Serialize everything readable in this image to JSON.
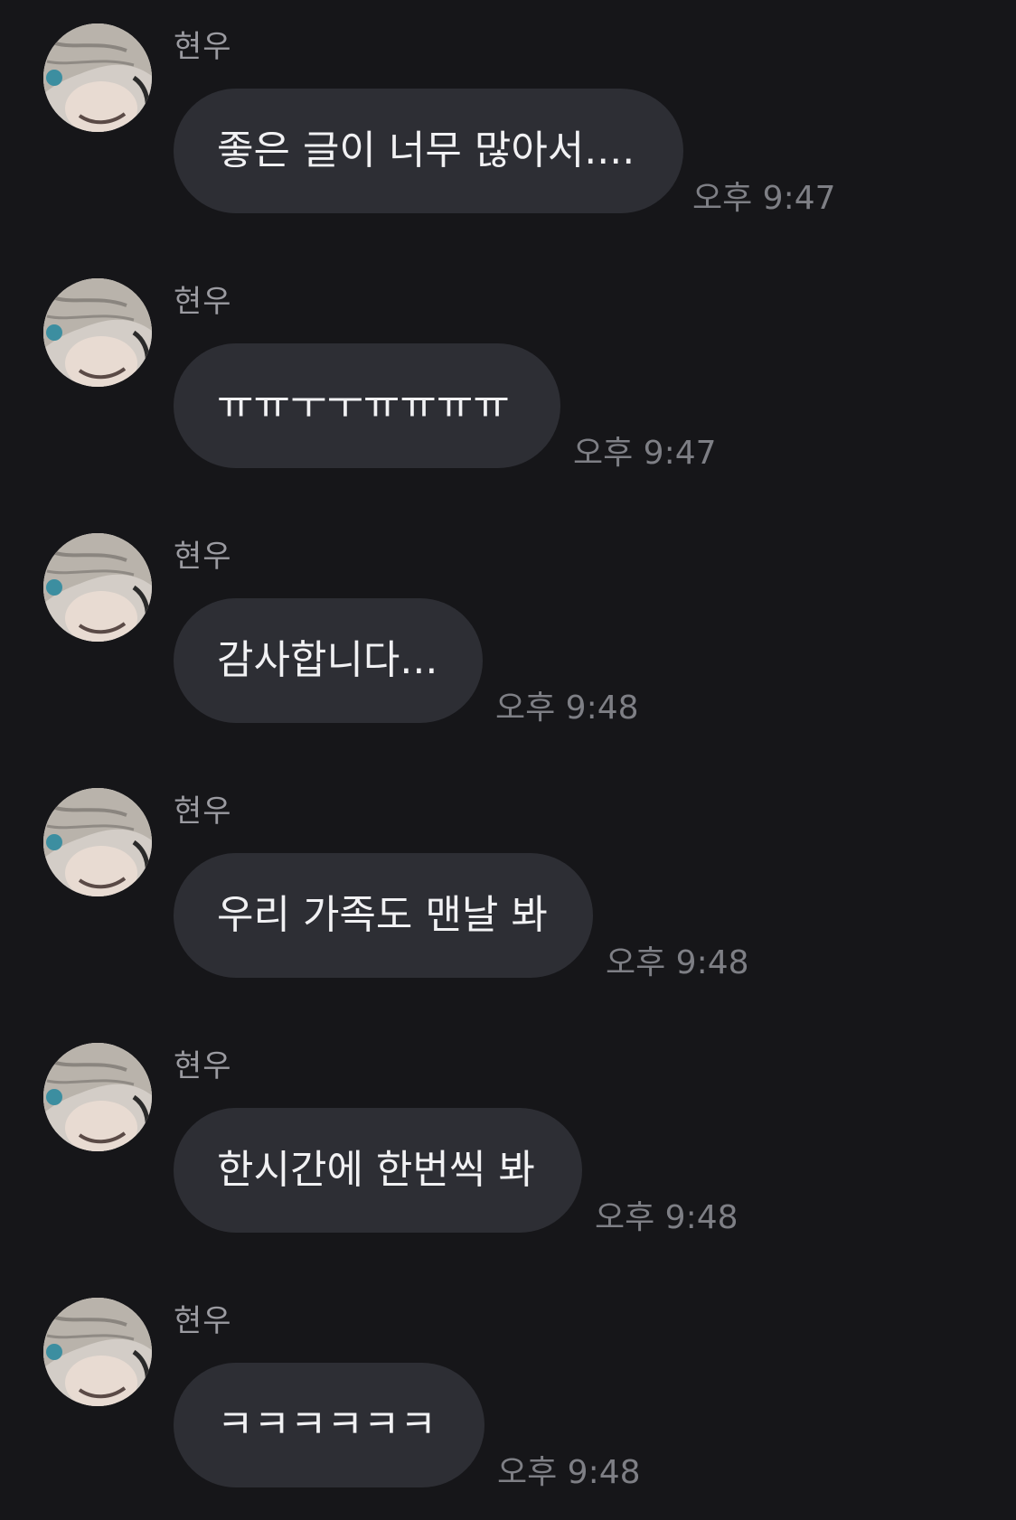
{
  "messages": [
    {
      "sender": "현우",
      "text": "좋은 글이 너무 많아서....",
      "time": "오후 9:47"
    },
    {
      "sender": "현우",
      "text": "ㅠㅠㅜㅜㅠㅠㅠㅠ",
      "time": "오후 9:47"
    },
    {
      "sender": "현우",
      "text": "감사합니다...",
      "time": "오후 9:48"
    },
    {
      "sender": "현우",
      "text": "우리 가족도 맨날 봐",
      "time": "오후 9:48"
    },
    {
      "sender": "현우",
      "text": "한시간에 한번씩 봐",
      "time": "오후 9:48"
    },
    {
      "sender": "현우",
      "text": "ㅋㅋㅋㅋㅋㅋ",
      "time": "오후 9:48"
    }
  ],
  "colors": {
    "background": "#161619",
    "bubble": "#2d2e34",
    "bubble_text": "#f1f1f3",
    "sender_name": "#9b9ba1",
    "timestamp": "#7e7f85"
  },
  "icons": {
    "avatar": "profile-photo-avatar"
  }
}
